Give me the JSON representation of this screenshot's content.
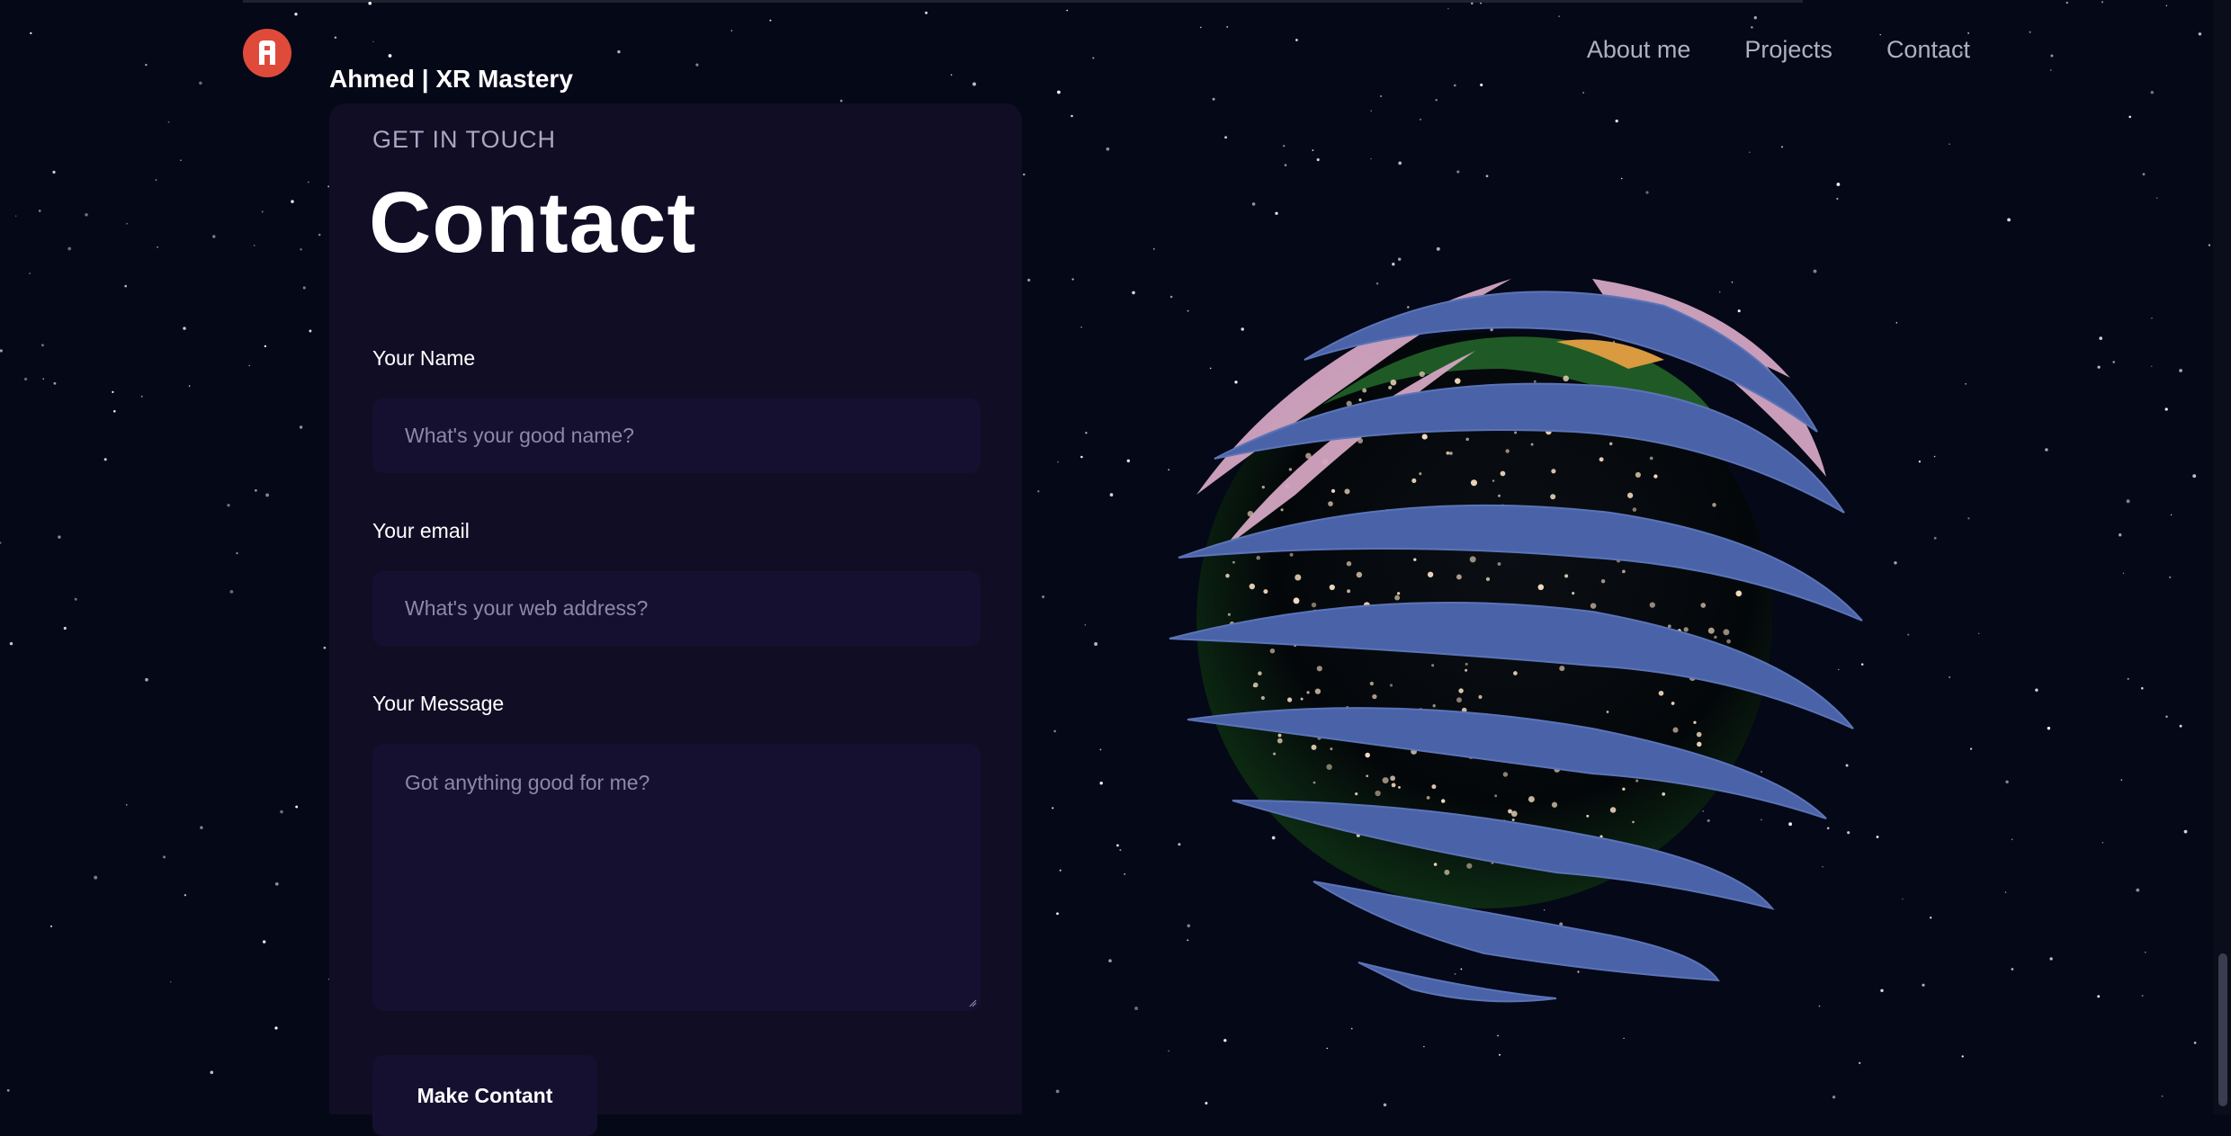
{
  "header": {
    "brand_name": "Ahmed",
    "brand_sep": " | XR Mastery",
    "nav": [
      {
        "label": "About me"
      },
      {
        "label": "Projects"
      },
      {
        "label": "Contact"
      }
    ]
  },
  "contact": {
    "eyebrow": "GET IN TOUCH",
    "title": "Contact",
    "name_label": "Your Name",
    "name_placeholder": "What's your good name?",
    "email_label": "Your email",
    "email_placeholder": "What's your web address?",
    "message_label": "Your Message",
    "message_placeholder": "Got anything good for me?",
    "submit_label": "Make Contant"
  },
  "icons": {
    "logo": "logo-icon",
    "globe": "earth-globe-icon"
  },
  "colors": {
    "background": "#050816",
    "card": "#100d25",
    "field": "#151030",
    "logo": "#e04a3b"
  }
}
